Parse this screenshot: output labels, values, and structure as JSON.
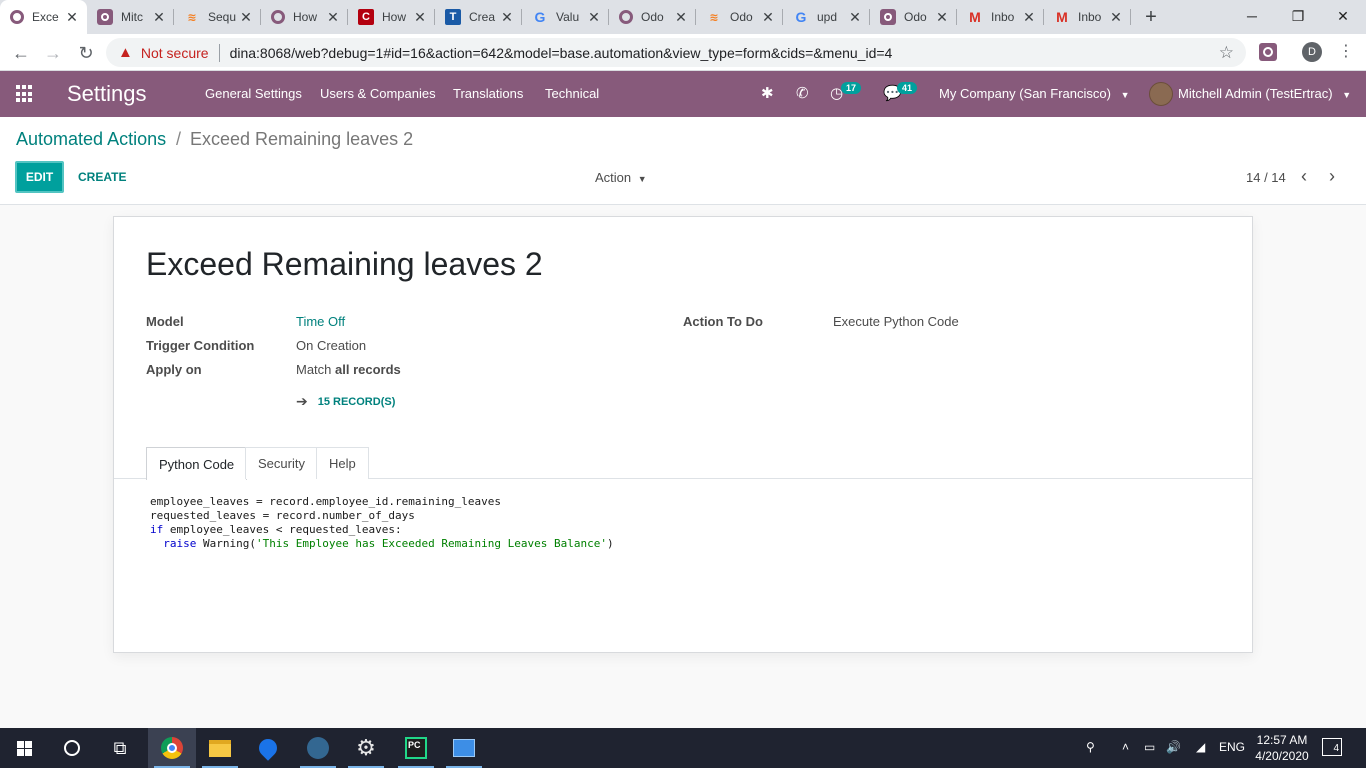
{
  "browser": {
    "tabs": [
      {
        "title": "Exce",
        "favicon": "odoo-icon",
        "active": true
      },
      {
        "title": "Mitc",
        "favicon": "odoo-icon"
      },
      {
        "title": "Sequ",
        "favicon": "stackoverflow-icon"
      },
      {
        "title": "How",
        "favicon": "odoo-icon"
      },
      {
        "title": "How",
        "favicon": "red-site-icon"
      },
      {
        "title": "Crea",
        "favicon": "t-site-icon"
      },
      {
        "title": "Valu",
        "favicon": "google-icon"
      },
      {
        "title": "Odo",
        "favicon": "odoo-icon"
      },
      {
        "title": "Odo",
        "favicon": "stackoverflow-icon"
      },
      {
        "title": "upd",
        "favicon": "google-icon"
      },
      {
        "title": "Odo",
        "favicon": "odoo-icon"
      },
      {
        "title": "Inbo",
        "favicon": "gmail-icon"
      },
      {
        "title": "Inbo",
        "favicon": "gmail-icon"
      }
    ],
    "security_label": "Not secure",
    "url": "dina:8068/web?debug=1#id=16&action=642&model=base.automation&view_type=form&cids=&menu_id=4",
    "profile_initial": "D"
  },
  "navbar": {
    "app_name": "Settings",
    "menus": [
      "General Settings",
      "Users & Companies",
      "Translations",
      "Technical"
    ],
    "activity_count": "17",
    "message_count": "41",
    "company": "My Company (San Francisco)",
    "user": "Mitchell Admin (TestErtrac)",
    "accent_color": "#875a7b"
  },
  "control_panel": {
    "breadcrumb_parent": "Automated Actions",
    "breadcrumb_separator": "/",
    "breadcrumb_current": "Exceed Remaining leaves 2",
    "edit_label": "EDIT",
    "create_label": "CREATE",
    "action_label": "Action",
    "pager": "14 / 14"
  },
  "form": {
    "title": "Exceed Remaining leaves 2",
    "fields": {
      "model_label": "Model",
      "model_value": "Time Off",
      "trigger_label": "Trigger Condition",
      "trigger_value": "On Creation",
      "apply_label": "Apply on",
      "apply_prefix": "Match",
      "apply_value": "all records",
      "action_label": "Action To Do",
      "action_value": "Execute Python Code"
    },
    "records_button": "15 RECORD(S)",
    "tabs": [
      "Python Code",
      "Security",
      "Help"
    ],
    "code": {
      "line1": "employee_leaves = record.employee_id.remaining_leaves",
      "line2": "requested_leaves = record.number_of_days",
      "line3_kw": "if",
      "line3_rest": " employee_leaves < requested_leaves:",
      "line4_kw": "raise",
      "line4_mid": " Warning(",
      "line4_str": "'This Employee has Exceeded Remaining Leaves Balance'",
      "line4_end": ")"
    }
  },
  "taskbar": {
    "language": "ENG",
    "time": "12:57 AM",
    "date": "4/20/2020",
    "notifications": "4"
  }
}
